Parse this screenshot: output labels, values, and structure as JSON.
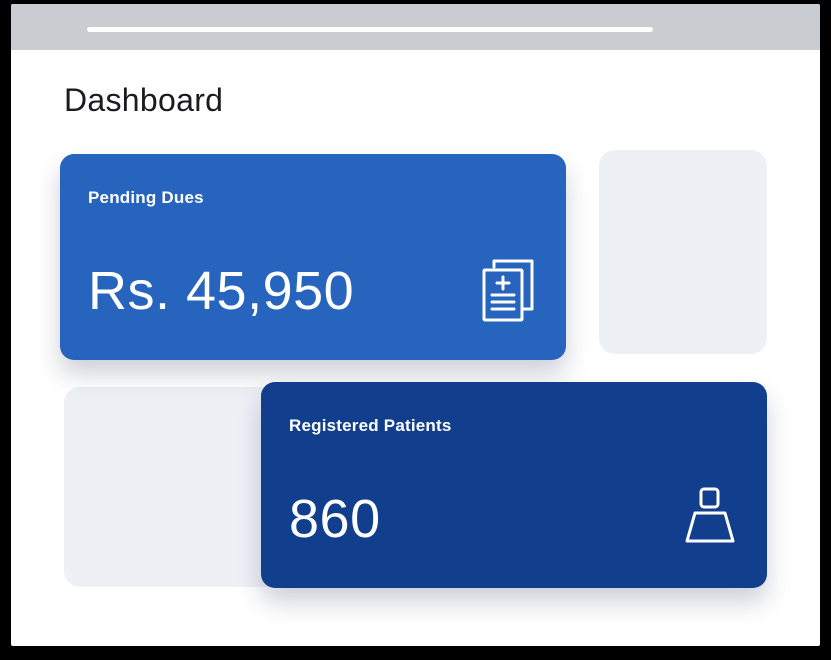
{
  "dashboard": {
    "title": "Dashboard"
  },
  "cards": {
    "pending_dues": {
      "label": "Pending Dues",
      "value": "Rs. 45,950",
      "icon": "medical-document-icon",
      "color": "#2664bd"
    },
    "registered_patients": {
      "label": "Registered Patients",
      "value": "860",
      "icon": "patient-icon",
      "color": "#113f8d"
    }
  }
}
